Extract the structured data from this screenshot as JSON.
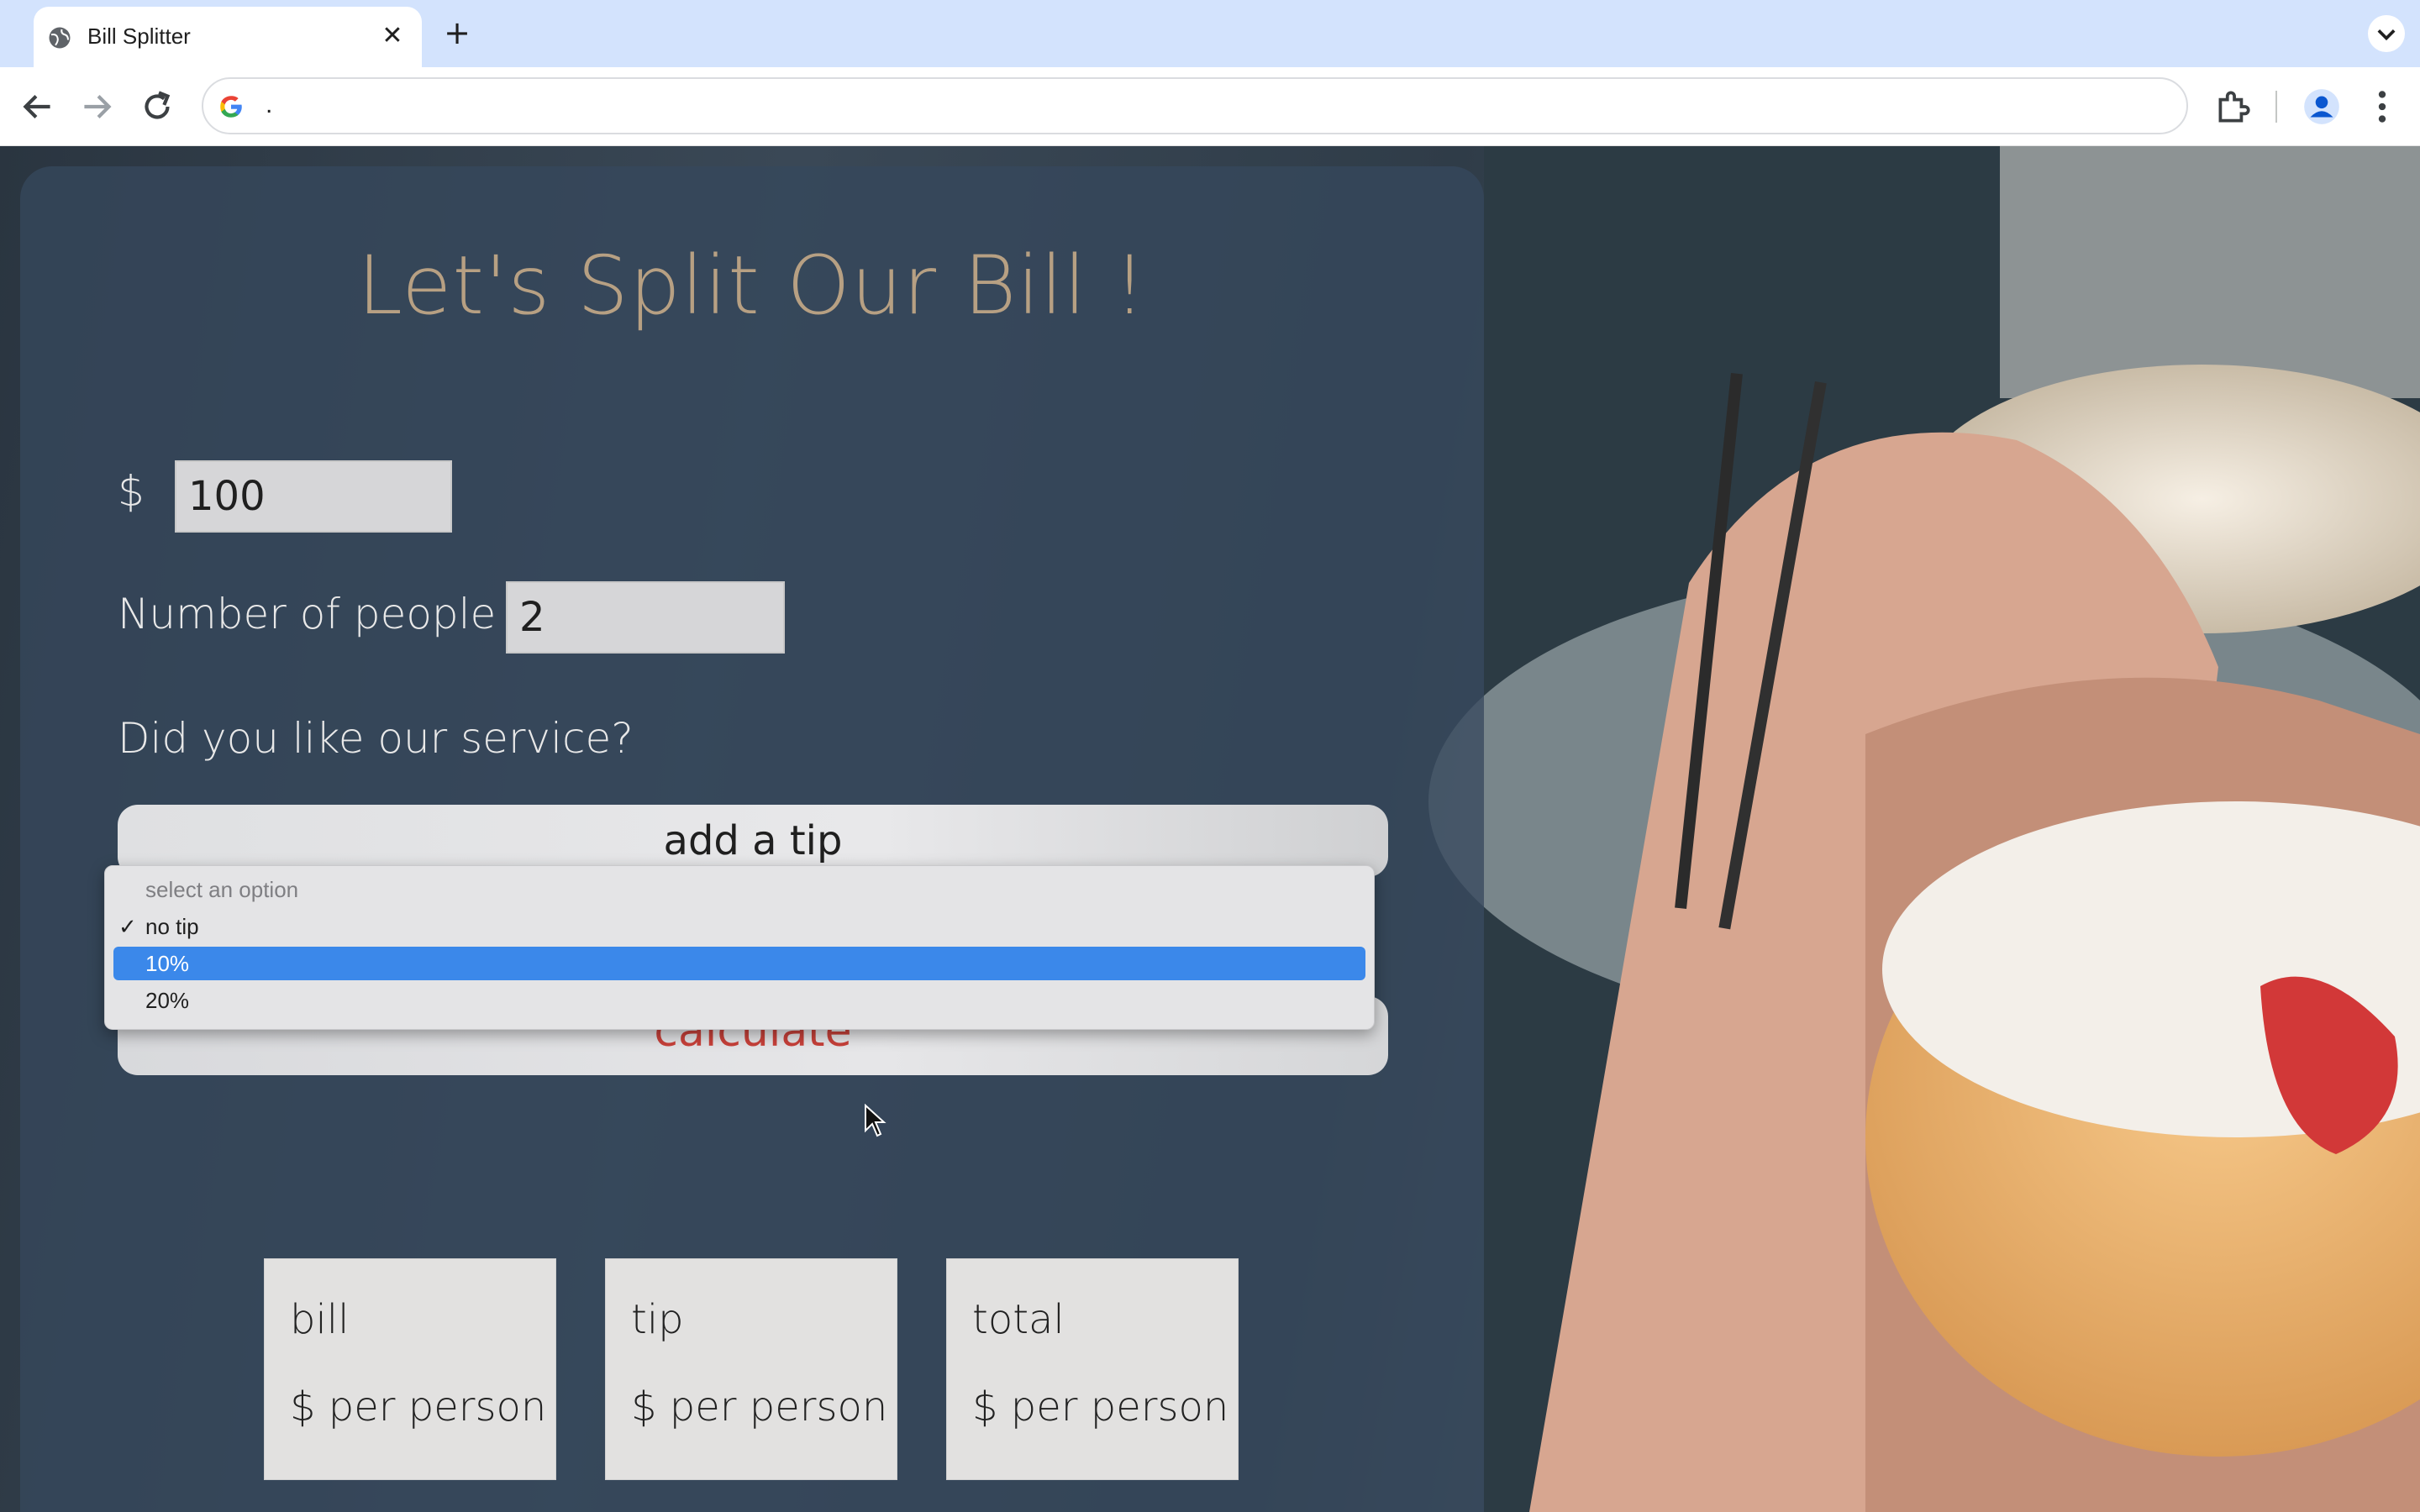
{
  "browser": {
    "tab_title": "Bill Splitter",
    "address": "."
  },
  "app": {
    "title": "Let's Split Our Bill !",
    "currency_label": "$",
    "bill_value": "100",
    "people_label": "Number of people",
    "people_value": "2",
    "service_question": "Did you like our service?",
    "tip_select_label": "add a tip",
    "calculate_label": "calculate",
    "tip_options": [
      {
        "label": "select an option",
        "state": "disabled"
      },
      {
        "label": "no tip",
        "state": "checked"
      },
      {
        "label": "10%",
        "state": "highlighted"
      },
      {
        "label": "20%",
        "state": "normal"
      }
    ],
    "results": [
      {
        "title": "bill",
        "sub": "$ per person"
      },
      {
        "title": "tip",
        "sub": "$ per person"
      },
      {
        "title": "total",
        "sub": "$ per person"
      }
    ]
  },
  "colors": {
    "title": "#b7a083",
    "calculate_text": "#c8413a",
    "highlight": "#3b88ea"
  },
  "icons": [
    "globe-icon",
    "close-icon",
    "plus-icon",
    "chevron-down-icon",
    "back-arrow-icon",
    "forward-arrow-icon",
    "reload-icon",
    "google-icon",
    "extensions-icon",
    "profile-icon",
    "more-vert-icon",
    "checkmark-icon",
    "cursor-icon"
  ]
}
